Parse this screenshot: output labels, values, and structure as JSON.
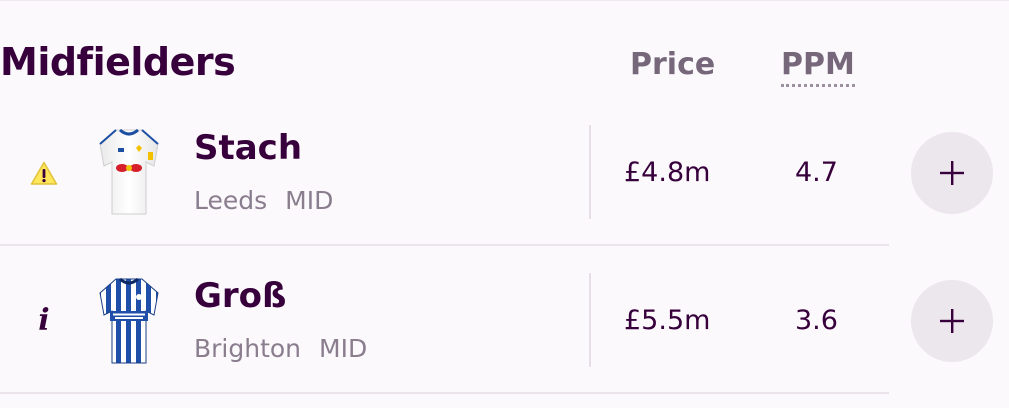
{
  "section": {
    "title": "Midfielders"
  },
  "columns": {
    "price": "Price",
    "ppm": "PPM"
  },
  "players": [
    {
      "name": "Stach",
      "team": "Leeds",
      "position": "MID",
      "price": "£4.8m",
      "ppm": "4.7",
      "status_icon": "warning-icon",
      "shirt_icon": "leeds-shirt-icon"
    },
    {
      "name": "Groß",
      "team": "Brighton",
      "position": "MID",
      "price": "£5.5m",
      "ppm": "3.6",
      "status_icon": "info-icon",
      "shirt_icon": "brighton-shirt-icon"
    }
  ],
  "colors": {
    "primary_text": "#37003c",
    "muted_text": "#8a7d8e",
    "header_text": "#76677a",
    "add_button_bg": "#ece6ed",
    "warning": "#ffe65b"
  }
}
